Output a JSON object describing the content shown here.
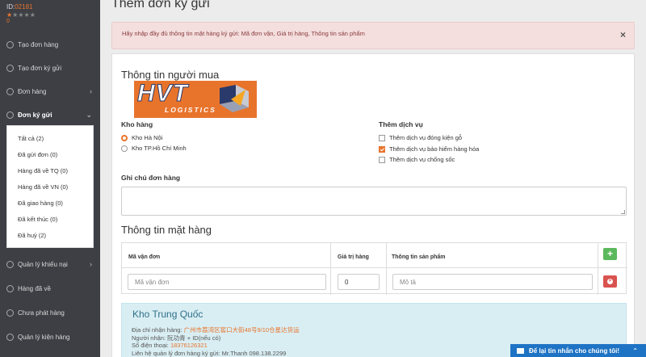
{
  "sidebar": {
    "id_label": "ID:",
    "id_value": "02181",
    "stars": [
      "★",
      "★",
      "★",
      "★",
      "★"
    ],
    "balance": "0",
    "items": [
      {
        "label": "Tạo đơn hàng"
      },
      {
        "label": "Tạo đơn ký gửi"
      },
      {
        "label": "Đơn hàng",
        "chevron": "›"
      },
      {
        "label": "Đơn ký gửi",
        "chevron": "⌄"
      },
      {
        "label": "Quản lý khiếu nại",
        "chevron": "›"
      },
      {
        "label": "Hàng đã về"
      },
      {
        "label": "Chưa phát hàng"
      },
      {
        "label": "Quản lý kiện hàng"
      }
    ],
    "submenu": [
      "Tất cả (2)",
      "Đã gửi đơn (0)",
      "Hàng đã về TQ (0)",
      "Hàng đã về VN (0)",
      "Đã giao hàng (0)",
      "Đã kết thúc (0)",
      "Đã huỷ (2)"
    ]
  },
  "page": {
    "title": "Thêm đơn ký gửi",
    "alert": "Hãy nhập đầy đủ thông tin mặt hàng ký gửi: Mã đơn vận, Giá trị hàng, Thông tin sản phẩm",
    "alert_close": "×"
  },
  "buyer": {
    "title": "Thông tin người mua",
    "warehouse_label": "Kho hàng",
    "warehouses": [
      "Kho Hà Nội",
      "Kho TP.Hồ Chí Minh"
    ],
    "services_label": "Thêm dịch vụ",
    "services": [
      "Thêm dịch vụ đóng kiện gỗ",
      "Thêm dịch vụ bảo hiểm hàng hóa",
      "Thêm dịch vụ chống sốc"
    ],
    "note_label": "Ghi chú đơn hàng"
  },
  "items": {
    "title": "Thông tin mặt hàng",
    "col_code": "Mã vận đơn",
    "col_value": "Giá trị hàng",
    "col_info": "Thông tin sản phẩm",
    "code_placeholder": "Mã vận đơn",
    "value": "0",
    "info_placeholder": "Mô tả",
    "add": "+",
    "remove": "×"
  },
  "china": {
    "title": "Kho Trung Quốc",
    "address_label": "Địa chỉ nhận hàng: ",
    "address": "广州市荔湾区窖口大街48号9/10仓星达货运",
    "receiver_label": "Người nhận: ",
    "receiver": "阮功青 + ID(nếu có)",
    "phone_label": "Số điện thoại: ",
    "phone": "18376126321",
    "contact": "Liên hệ quản lý đơn hàng ký gửi: Mr.Thanh 098.138.2299"
  },
  "logo": {
    "main": "HVT",
    "sub": "LOGISTICS"
  },
  "chat": {
    "label": "Để lại tin nhắn cho chúng tôi!",
    "chevron": "⌃"
  },
  "colors": {
    "accent": "#e8742c",
    "sidebar": "#3d3f45",
    "chat": "#1e73c4"
  }
}
